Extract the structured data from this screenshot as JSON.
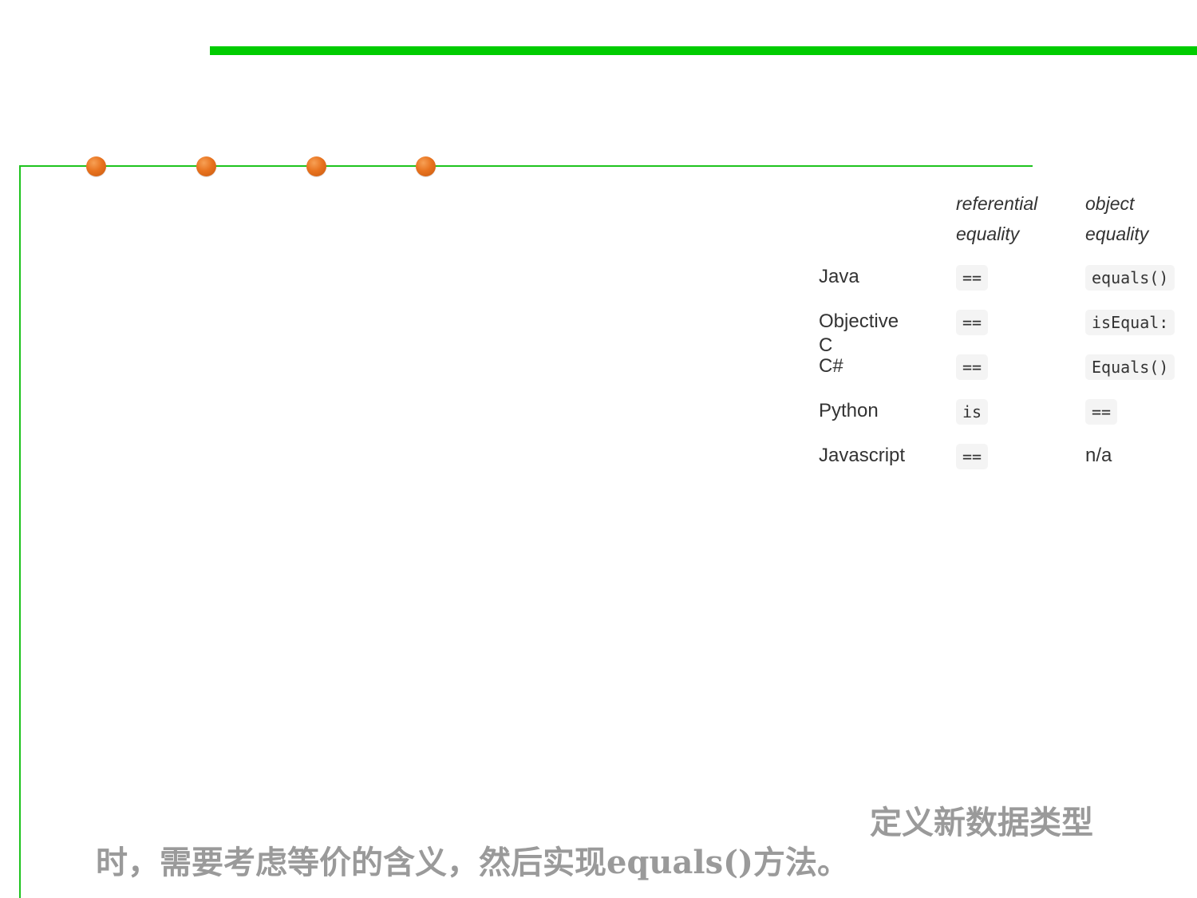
{
  "colors": {
    "accent_green": "#00cc00",
    "frame_green": "#1ec31e",
    "bullet_orange": "#e8731f",
    "caption_gray": "#9a9a9a"
  },
  "table": {
    "headers": {
      "ref": [
        "referential",
        "equality"
      ],
      "obj": [
        "object",
        "equality"
      ]
    },
    "rows": [
      {
        "lang": "Java",
        "ref": "==",
        "obj": "equals()"
      },
      {
        "lang": "Objective C",
        "ref": "==",
        "obj": "isEqual:"
      },
      {
        "lang": "C#",
        "ref": "==",
        "obj": "Equals()"
      },
      {
        "lang": "Python",
        "ref": "is",
        "obj": "=="
      },
      {
        "lang": "Javascript",
        "ref": "==",
        "obj": "n/a"
      }
    ]
  },
  "caption": {
    "line1": "定义新数据类型",
    "line2": "时，需要考虑等价的含义，然后实现equals()方法。"
  }
}
